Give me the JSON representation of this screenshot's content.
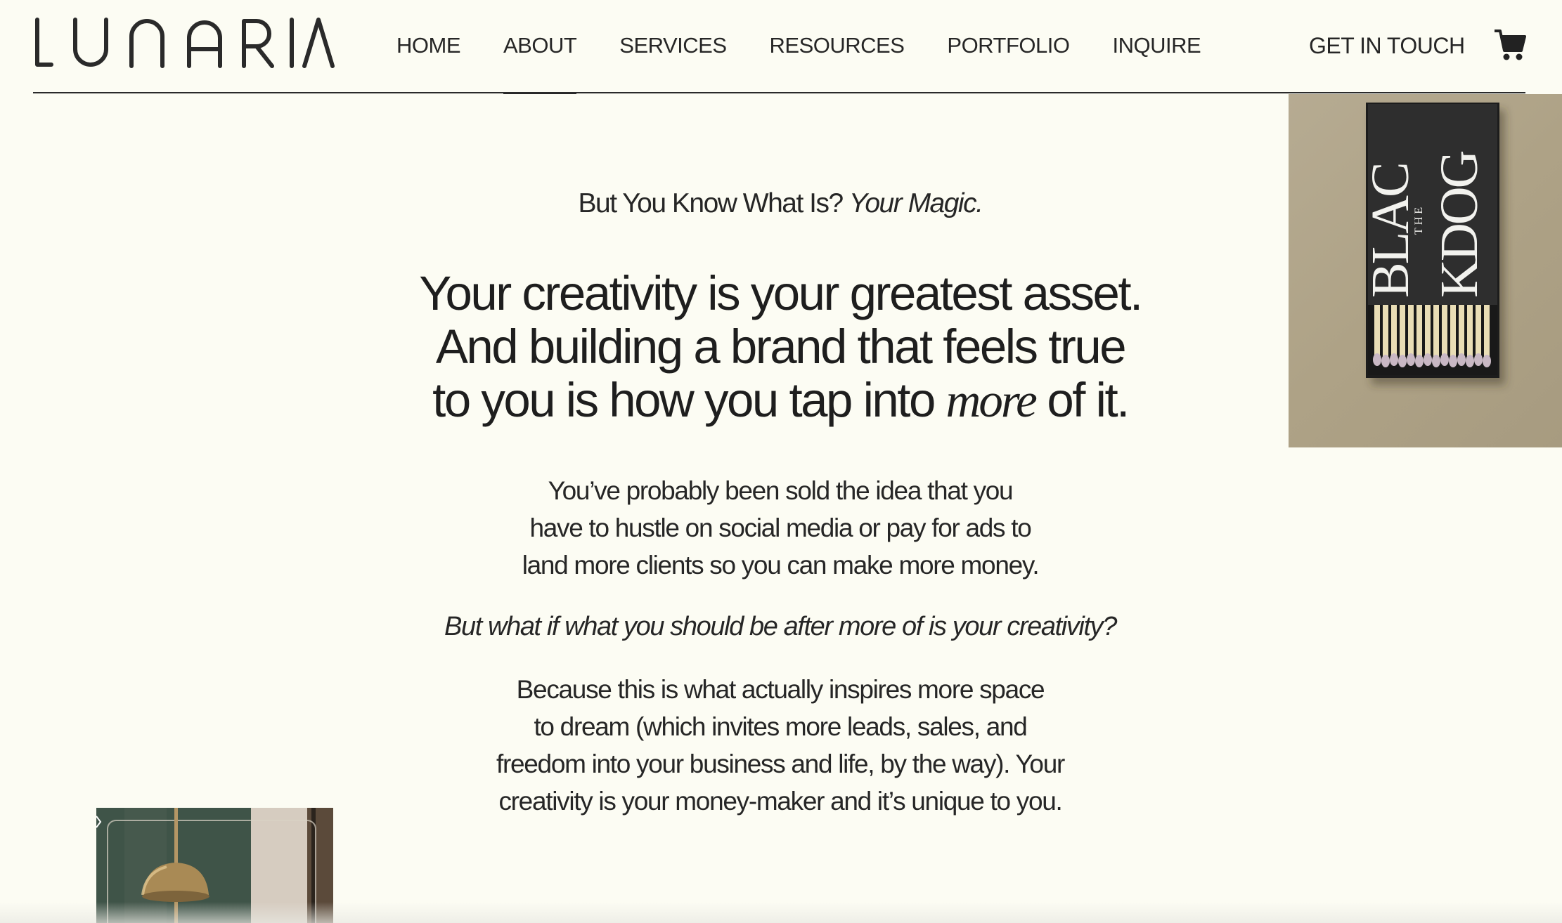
{
  "brand": {
    "logo_text": "LUNARIA"
  },
  "nav": {
    "items": [
      {
        "label": "HOME"
      },
      {
        "label": "ABOUT",
        "active": true
      },
      {
        "label": "SERVICES"
      },
      {
        "label": "RESOURCES"
      },
      {
        "label": "PORTFOLIO"
      },
      {
        "label": "INQUIRE"
      }
    ],
    "cta_label": "GET IN TOUCH",
    "cart_icon": "cart-icon"
  },
  "hero_image": {
    "label_lines": [
      "BLAC",
      "THE",
      "KDOG"
    ]
  },
  "content": {
    "eyebrow_text": "But You Know What Is?",
    "eyebrow_italic": "Your Magic.",
    "headline_line1": "Your creativity is your greatest asset.",
    "headline_line2": "And building a brand that feels true",
    "headline_line3_a": "to you is how you tap into",
    "headline_line3_em": "more",
    "headline_line3_b": "of it.",
    "para1_line1": "You’ve probably been sold the idea that you",
    "para1_line2": "have to hustle on social media or pay for ads to",
    "para1_line3": "land more clients so you can make more money.",
    "italic_question": "But what if what you should be after more of is your creativity?",
    "para2_line1": "Because this is what actually inspires more space",
    "para2_line2": "to dream (which invites more leads, sales, and",
    "para2_line3": "freedom into your business and life, by the way). Your",
    "para2_line4": "creativity is your money-maker and it’s unique to you."
  },
  "colors": {
    "background": "#fcfcf3",
    "text": "#1f1f1f",
    "matchbox_bg": "#ada186",
    "matchbox": "#2b2b2b"
  }
}
